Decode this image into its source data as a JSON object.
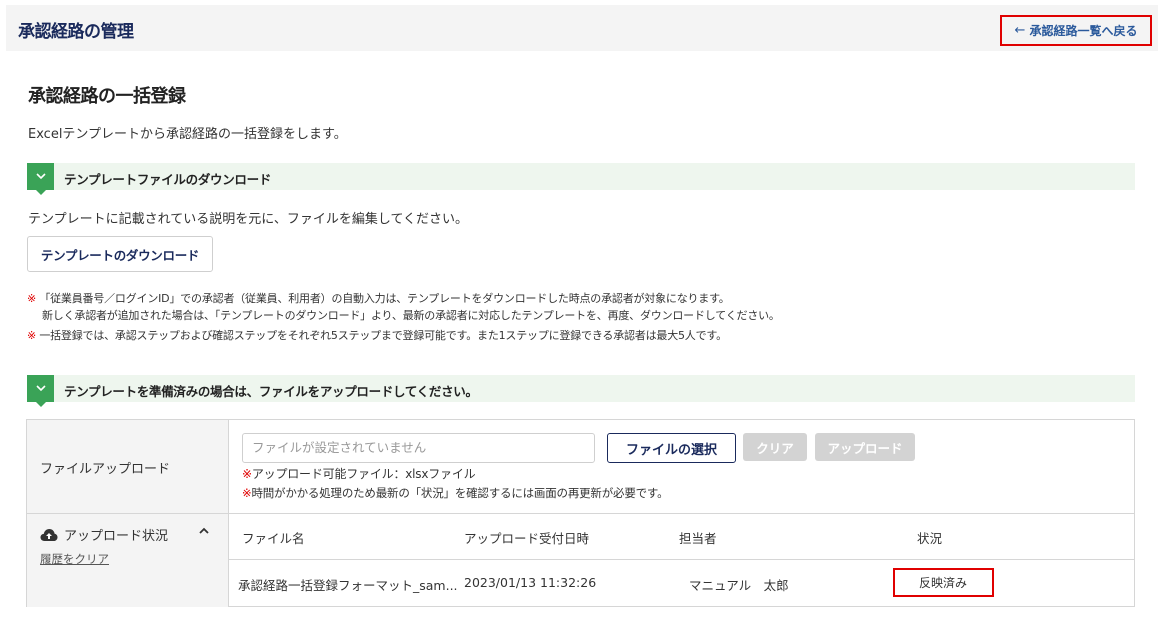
{
  "header": {
    "title": "承認経路の管理",
    "back_link": "承認経路一覧へ戻る",
    "back_icon": "arrow-left-icon"
  },
  "page": {
    "title": "承認経路の一括登録",
    "description": "Excelテンプレートから承認経路の一括登録をします。"
  },
  "section1": {
    "label": "テンプレートファイルのダウンロード",
    "description": "テンプレートに記載されている説明を元に、ファイルを編集してください。",
    "download_button": "テンプレートのダウンロード",
    "note_mark": "※",
    "note1": "「従業員番号／ログインID」での承認者（従業員、利用者）の自動入力は、テンプレートをダウンロードした時点の承認者が対象になります。",
    "note2": "新しく承認者が追加された場合は、「テンプレートのダウンロード」より、最新の承認者に対応したテンプレートを、再度、ダウンロードしてください。",
    "note3": "一括登録では、承認ステップおよび確認ステップをそれぞれ5ステップまで登録可能です。また1ステップに登録できる承認者は最大5人です。"
  },
  "section2": {
    "label": "テンプレートを準備済みの場合は、ファイルをアップロードしてください。",
    "upload_label": "ファイルアップロード",
    "file_placeholder": "ファイルが設定されていません",
    "select_button": "ファイルの選択",
    "clear_button": "クリア",
    "upload_button": "アップロード",
    "note_mark": "※",
    "file_note1": "アップロード可能ファイル：xlsxファイル",
    "file_note2": "時間がかかる処理のため最新の「状況」を確認するには画面の再更新が必要です。"
  },
  "history": {
    "title": "アップロード状況",
    "clear_link": "履歴をクリア",
    "columns": [
      "ファイル名",
      "アップロード受付日時",
      "担当者",
      "状況"
    ],
    "rows": [
      {
        "file_name": "承認経路一括登録フォーマット_sam...",
        "received_at": "2023/01/13 11:32:26",
        "owner": "マニュアル　太郎",
        "status": "反映済み"
      }
    ]
  },
  "colors": {
    "accent_green": "#3aa357",
    "navy": "#1a2a5c",
    "highlight_red": "#e00000"
  }
}
